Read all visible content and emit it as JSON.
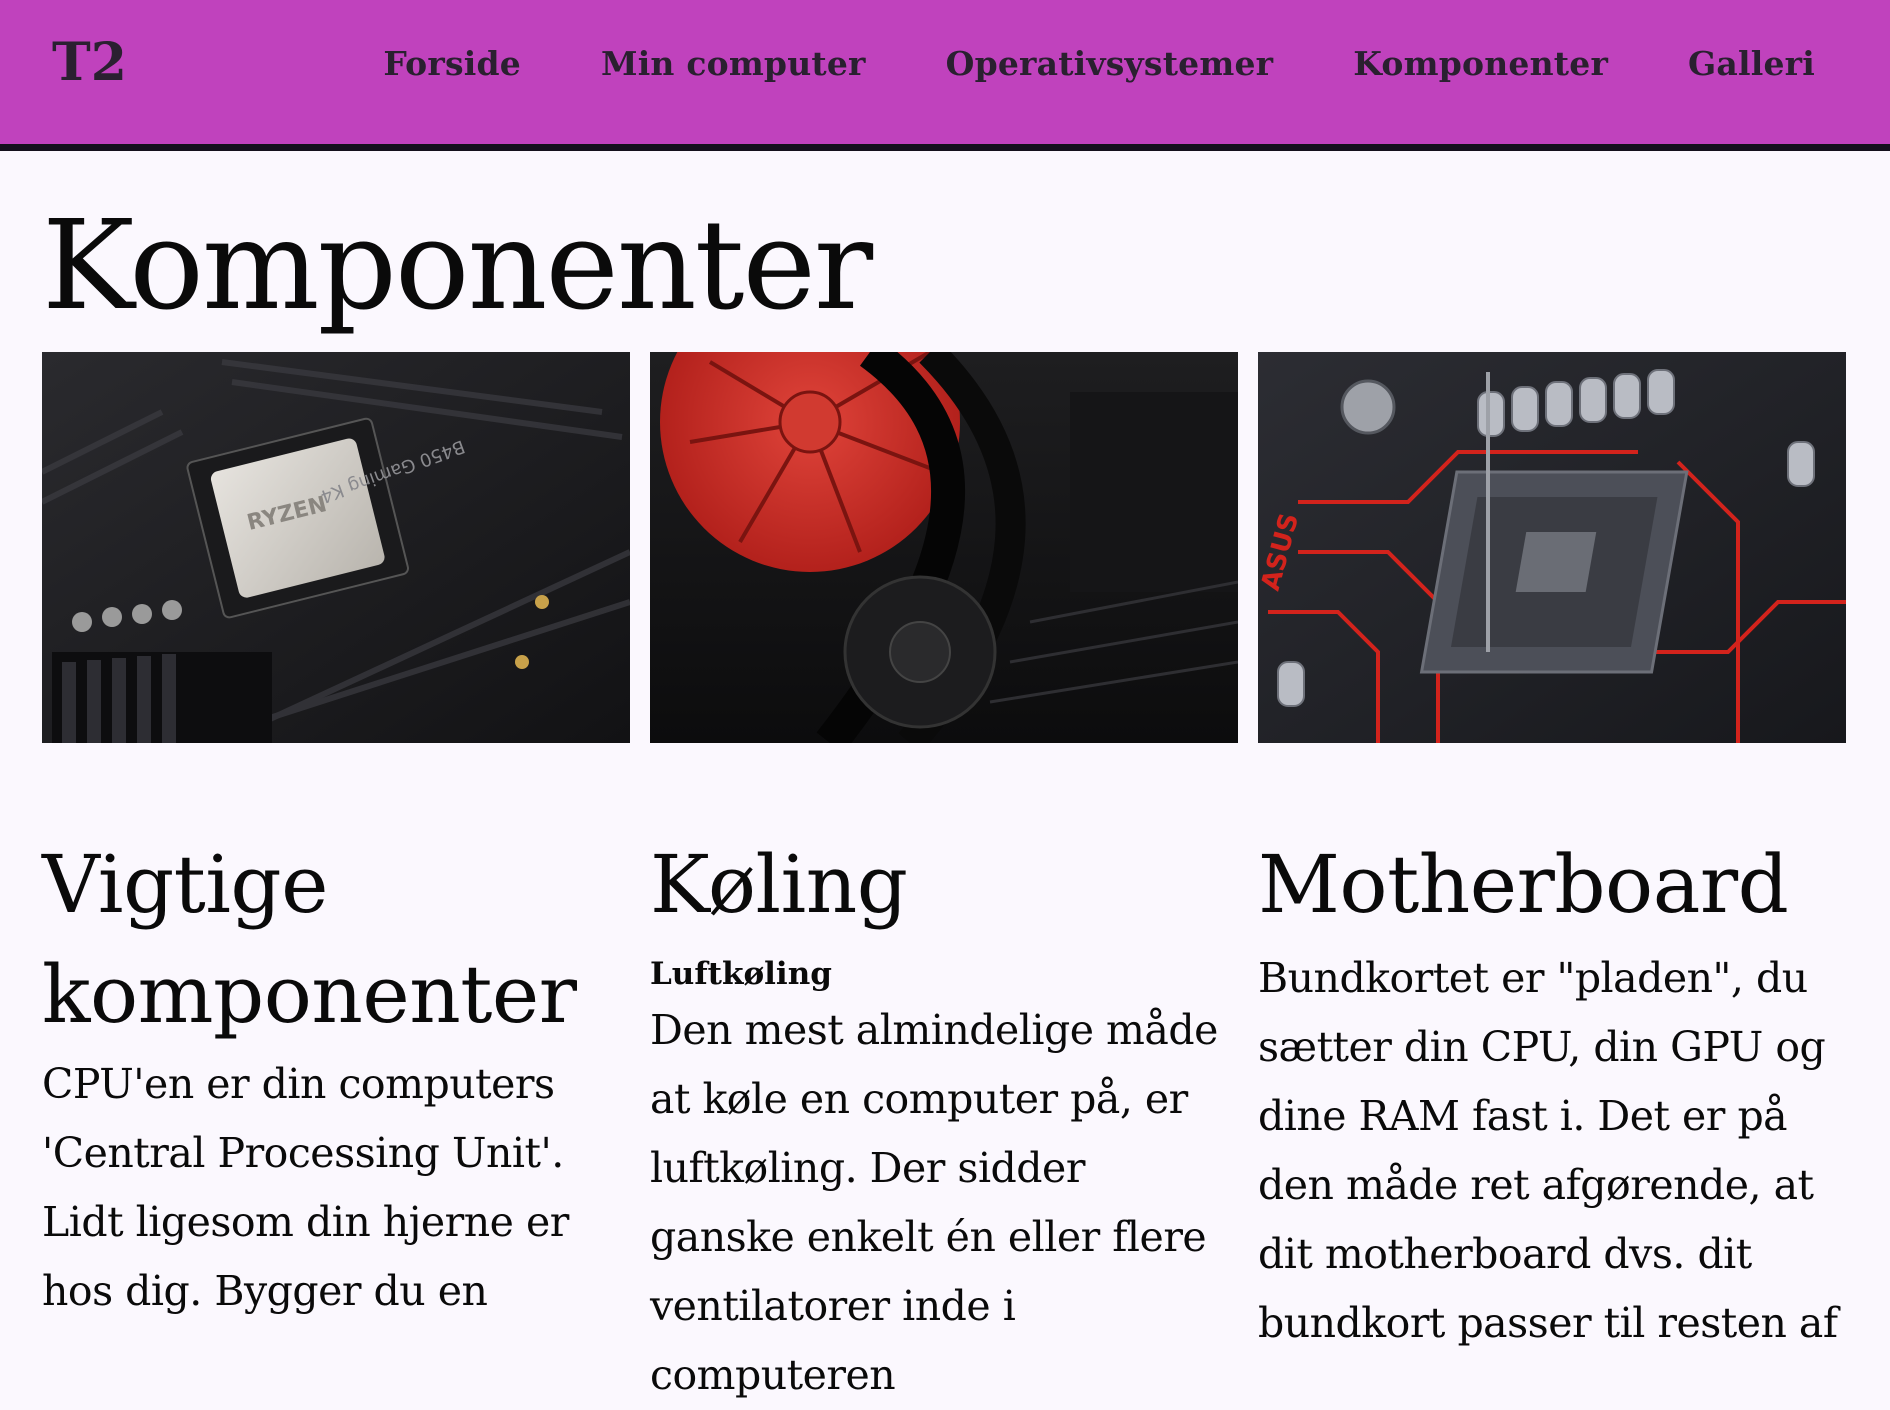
{
  "header": {
    "logo": "T2",
    "brand_color": "#c042bd",
    "nav": [
      {
        "label": "Forside"
      },
      {
        "label": "Min computer"
      },
      {
        "label": "Operativsystemer"
      },
      {
        "label": "Komponenter"
      },
      {
        "label": "Galleri"
      }
    ]
  },
  "main": {
    "title": "Komponenter",
    "images": [
      {
        "name": "cpu-motherboard-photo"
      },
      {
        "name": "red-cpu-cooler-photo"
      },
      {
        "name": "cpu-socket-photo"
      }
    ],
    "sections": [
      {
        "heading": "Vigtige komponenter",
        "subheading": "",
        "body": "CPU'en er din computers 'Central Processing Unit'. Lidt ligesom din hjerne er hos dig. Bygger du en"
      },
      {
        "heading": "Køling",
        "subheading": "Luftkøling",
        "body": "Den mest almindelige måde at køle en computer på, er luftkøling. Der sidder ganske enkelt én eller flere ventilatorer inde i computeren"
      },
      {
        "heading": "Motherboard",
        "subheading": "",
        "body": "Bundkortet er \"pladen\", du sætter din CPU, din GPU og dine RAM fast i. Det er på den måde ret afgørende, at dit motherboard dvs. dit bundkort passer til resten af"
      }
    ]
  }
}
